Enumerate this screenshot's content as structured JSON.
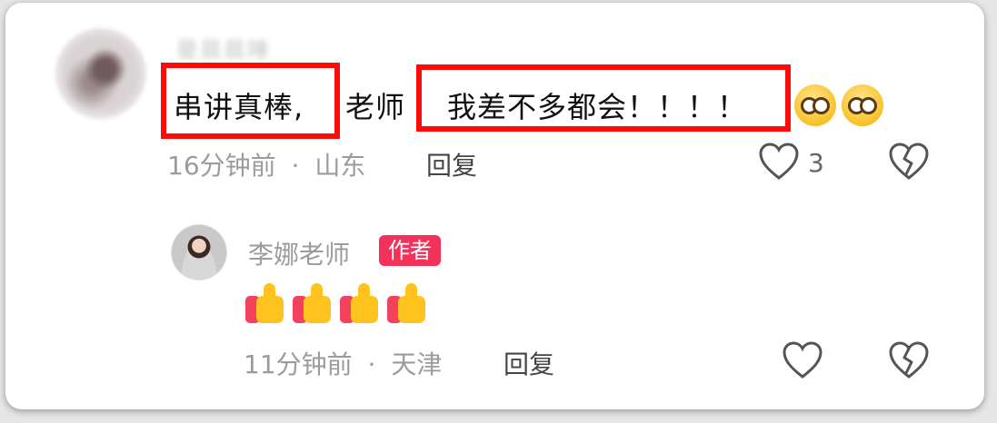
{
  "comment": {
    "username": "曼晨晨睡",
    "segments": [
      "串讲真棒,",
      "老师",
      "我差不多都会！！！！"
    ],
    "emojis": [
      "pleading-face-icon",
      "pleading-face-icon"
    ],
    "time": "16分钟前",
    "location": "山东",
    "reply_label": "回复",
    "like_count": "3"
  },
  "reply": {
    "author_name": "李娜老师",
    "author_badge": "作者",
    "content_icons": [
      "thumbs-up-icon",
      "thumbs-up-icon",
      "thumbs-up-icon",
      "thumbs-up-icon"
    ],
    "time": "11分钟前",
    "location": "天津",
    "reply_label": "回复"
  },
  "colors": {
    "highlight_box": "#ff0a0a",
    "badge": "#f2325a",
    "meta_text": "#9b9b9b"
  }
}
